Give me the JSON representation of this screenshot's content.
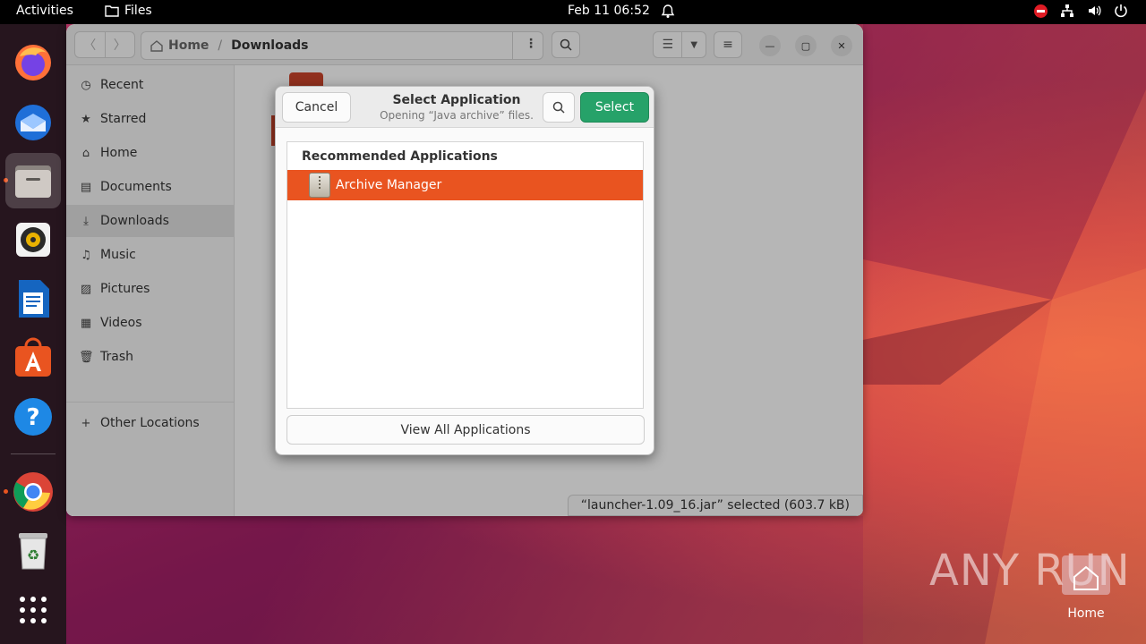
{
  "topbar": {
    "activities": "Activities",
    "app_name": "Files",
    "clock": "Feb 11  06:52"
  },
  "dock": {
    "items": [
      "firefox-icon",
      "thunderbird-icon",
      "files-icon",
      "rhythmbox-icon",
      "writer-icon",
      "app-center-icon",
      "help-icon",
      "chrome-icon",
      "trash-icon",
      "show-apps-icon"
    ]
  },
  "files": {
    "path_home": "Home",
    "path_current": "Downloads",
    "sidebar": [
      {
        "label": "Recent",
        "icon": "◷"
      },
      {
        "label": "Starred",
        "icon": "★"
      },
      {
        "label": "Home",
        "icon": "⌂"
      },
      {
        "label": "Documents",
        "icon": "▤"
      },
      {
        "label": "Downloads",
        "icon": "⤓"
      },
      {
        "label": "Music",
        "icon": "♫"
      },
      {
        "label": "Pictures",
        "icon": "▨"
      },
      {
        "label": "Videos",
        "icon": "▦"
      },
      {
        "label": "Trash",
        "icon": "🗑"
      }
    ],
    "other_locations": "Other Locations",
    "status": "“launcher-1.09_16.jar” selected  (603.7 kB)"
  },
  "dialog": {
    "cancel": "Cancel",
    "title": "Select Application",
    "subtitle": "Opening “Java archive” files.",
    "select": "Select",
    "section_heading": "Recommended Applications",
    "apps": [
      "Archive Manager"
    ],
    "view_all": "View All Applications"
  },
  "desktop": {
    "home_label": "Home",
    "watermark": "ANY RUN"
  },
  "colors": {
    "accent": "#e95420",
    "select_button": "#26a269"
  }
}
